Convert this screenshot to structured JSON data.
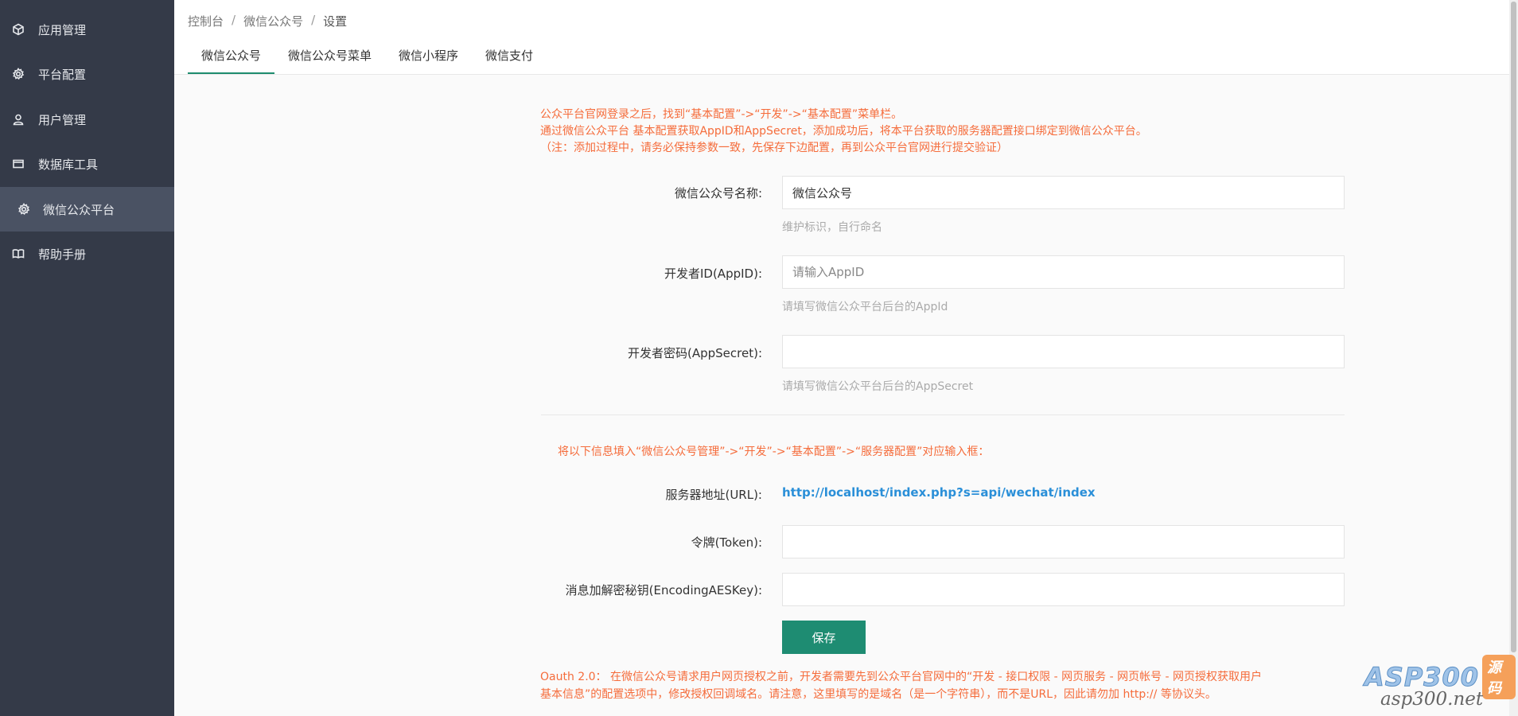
{
  "sidebar": {
    "items": [
      {
        "label": "应用管理",
        "icon": "cube-icon"
      },
      {
        "label": "平台配置",
        "icon": "gear-icon"
      },
      {
        "label": "用户管理",
        "icon": "user-icon"
      },
      {
        "label": "数据库工具",
        "icon": "database-icon"
      },
      {
        "label": "微信公众平台",
        "icon": "gear-icon",
        "active": true
      },
      {
        "label": "帮助手册",
        "icon": "book-icon"
      }
    ]
  },
  "breadcrumb": [
    "控制台",
    "微信公众号",
    "设置"
  ],
  "tabs": [
    {
      "label": "微信公众号",
      "active": true
    },
    {
      "label": "微信公众号菜单"
    },
    {
      "label": "微信小程序"
    },
    {
      "label": "微信支付"
    }
  ],
  "intro": {
    "line1": "公众平台官网登录之后，找到“基本配置”->“开发”->“基本配置”菜单栏。",
    "line2": "通过微信公众平台 基本配置获取AppID和AppSecret，添加成功后，将本平台获取的服务器配置接口绑定到微信公众平台。",
    "line3": "（注：添加过程中，请务必保持参数一致，先保存下边配置，再到公众平台官网进行提交验证）"
  },
  "form": {
    "name": {
      "label": "微信公众号名称:",
      "value": "微信公众号",
      "help": "维护标识，自行命名"
    },
    "appid": {
      "label": "开发者ID(AppID):",
      "placeholder": "请输入AppID",
      "value": "",
      "help": "请填写微信公众平台后台的AppId"
    },
    "secret": {
      "label": "开发者密码(AppSecret):",
      "value": "",
      "help": "请填写微信公众平台后台的AppSecret"
    }
  },
  "server": {
    "intro": "将以下信息填入“微信公众号管理”->“开发”->“基本配置”->“服务器配置”对应输入框：",
    "url_label": "服务器地址(URL):",
    "url_value": "http://localhost/index.php?s=api/wechat/index",
    "token_label": "令牌(Token):",
    "token_value": "",
    "aes_label": "消息加解密秘钥(EncodingAESKey):",
    "aes_value": ""
  },
  "save_label": "保存",
  "oauth": {
    "line1": "Oauth 2.0：  在微信公众号请求用户网页授权之前，开发者需要先到公众平台官网中的“开发 - 接口权限 - 网页服务 - 网页帐号 - 网页授权获取用户",
    "line2": "基本信息”的配置选项中，修改授权回调域名。请注意，这里填写的是域名（是一个字符串），而不是URL，因此请勿加 http:// 等协议头。"
  },
  "watermark": {
    "brand": "ASP300",
    "badge": "源码",
    "domain": "asp300.net"
  }
}
